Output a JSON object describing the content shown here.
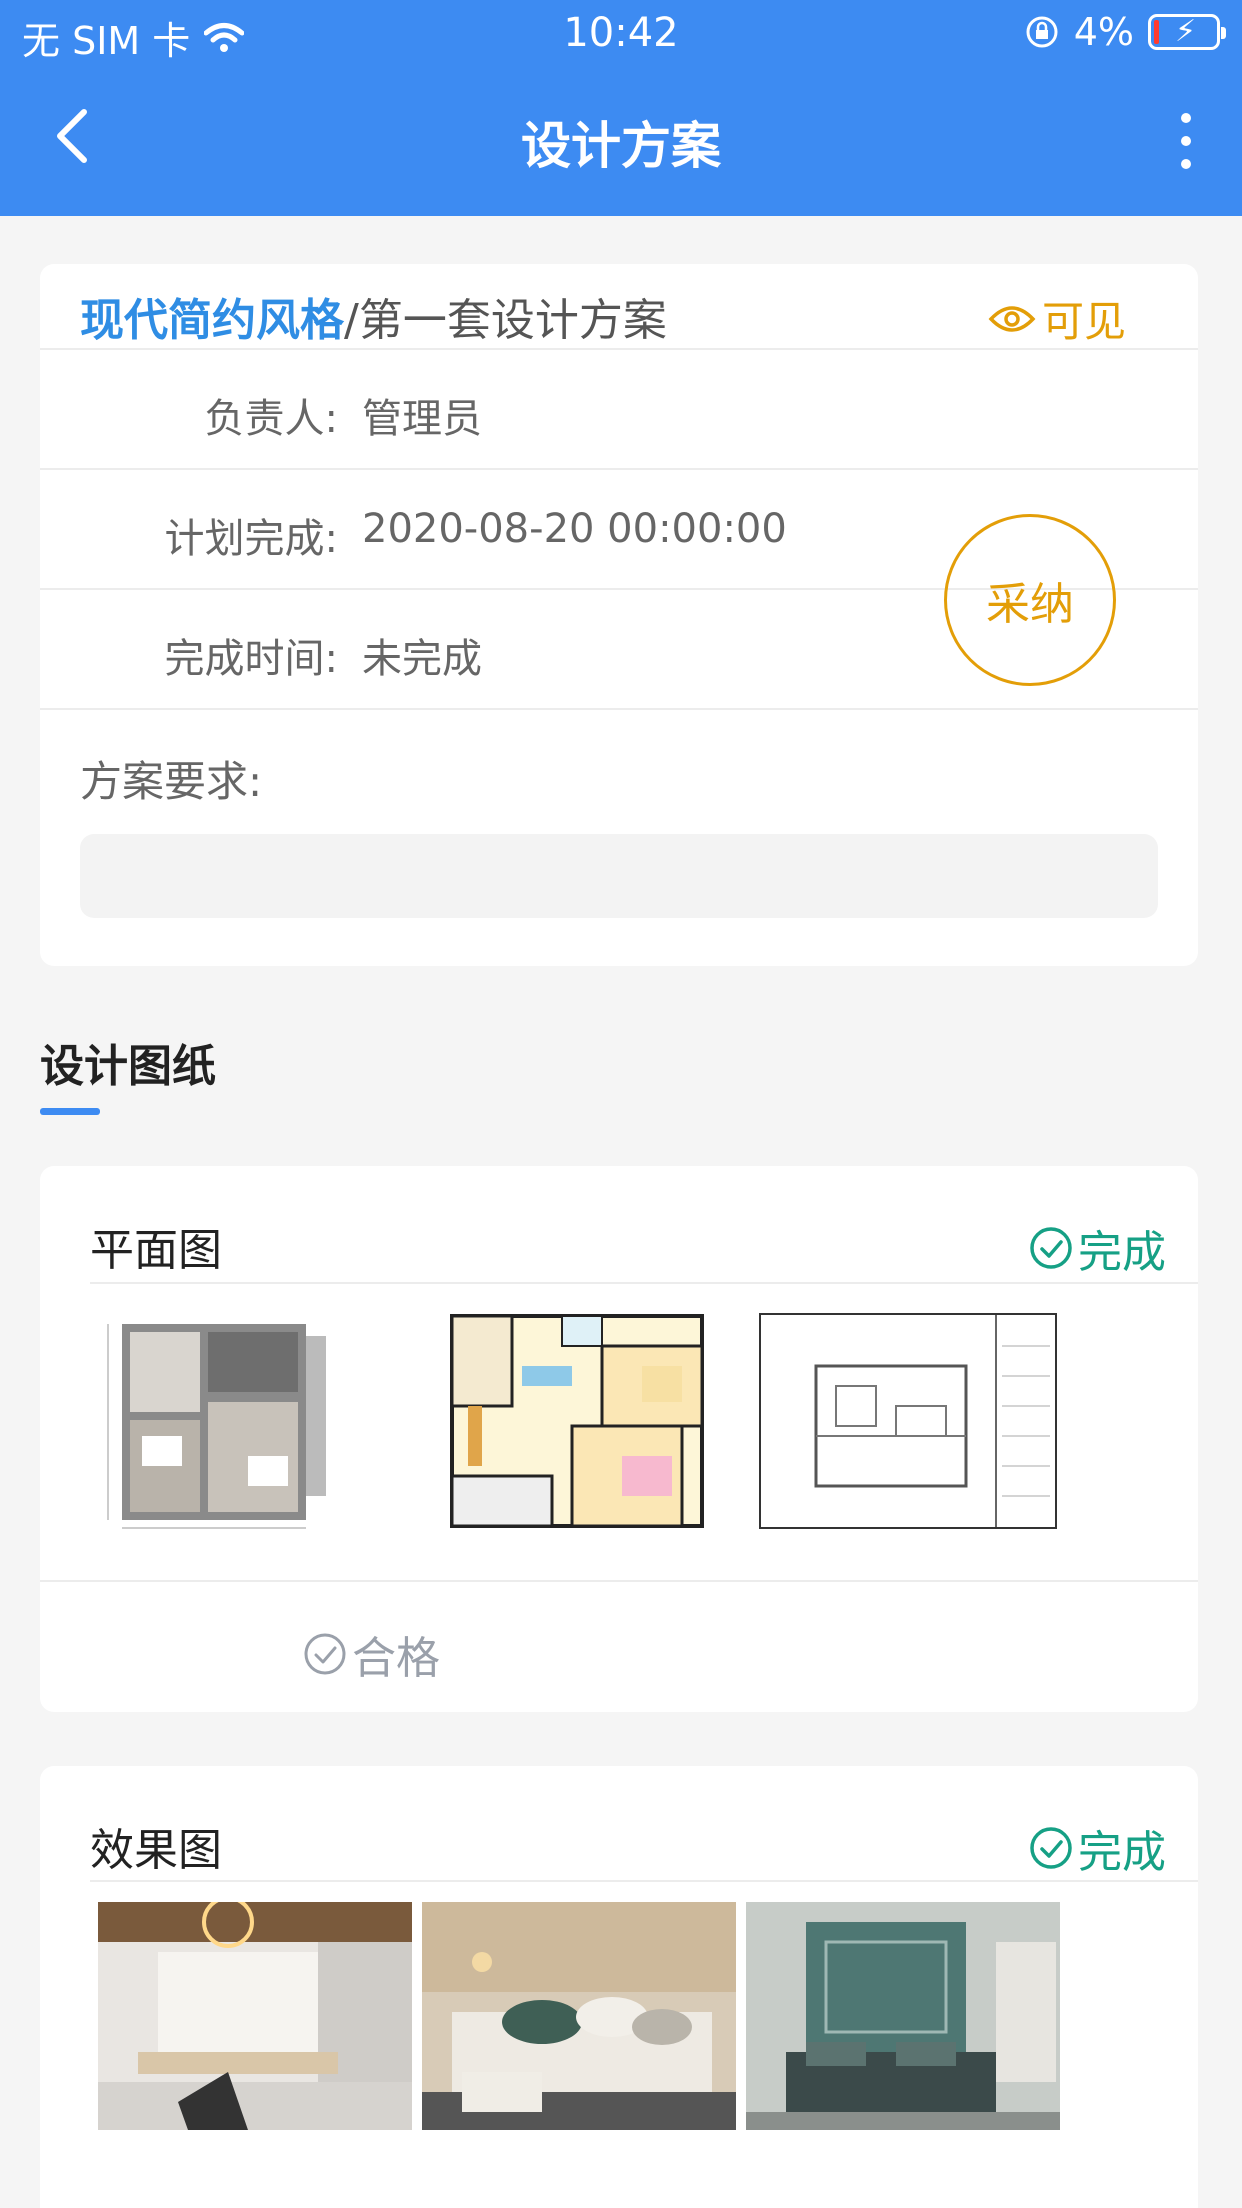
{
  "status_bar": {
    "carrier": "无 SIM 卡",
    "time": "10:42",
    "battery": "4%"
  },
  "nav": {
    "title": "设计方案"
  },
  "scheme": {
    "style": "现代简约风格",
    "separator": "/",
    "name": "第一套设计方案",
    "visibility": "可见",
    "adopt_label": "采纳",
    "rows": [
      {
        "label": "负责人:",
        "value": "管理员"
      },
      {
        "label": "计划完成:",
        "value": "2020-08-20 00:00:00"
      },
      {
        "label": "完成时间:",
        "value": "未完成"
      }
    ],
    "requirement_label": "方案要求:",
    "requirement_value": ""
  },
  "drawings": {
    "section_title": "设计图纸",
    "cards": [
      {
        "title": "平面图",
        "status": "完成",
        "images": [
          "floor-plan-rendered",
          "floor-plan-colored",
          "floor-plan-cad"
        ],
        "inspection": "合格"
      },
      {
        "title": "效果图",
        "status": "完成",
        "images": [
          "kitchen-render",
          "bedroom-render",
          "teal-bedroom-render"
        ]
      }
    ]
  },
  "colors": {
    "primary": "#3d8bf2",
    "accent": "#e39e08",
    "success": "#16a085",
    "link": "#2f8de4"
  }
}
